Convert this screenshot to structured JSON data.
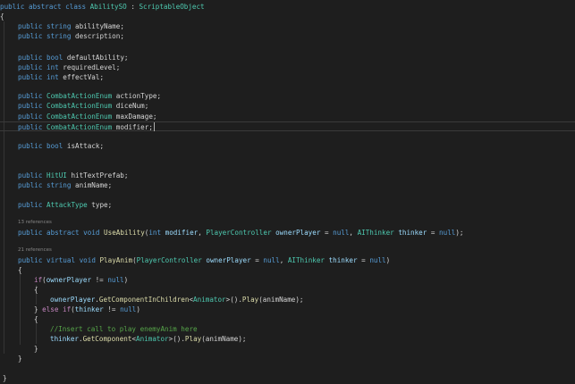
{
  "editor": {
    "language": "csharp",
    "theme": {
      "background": "#1e1e1e",
      "keyword": "#569cd6",
      "type": "#4ec9b0",
      "method": "#dcdcaa",
      "parameter": "#9cdcfe",
      "comment": "#57a64a",
      "control": "#c586c0",
      "plain": "#d4d4d4"
    },
    "codelens": {
      "refs_useability": "13 references",
      "refs_playanim": "21 references"
    },
    "lines": [
      {
        "tokens": [
          [
            "kw",
            "public"
          ],
          [
            "pl",
            " "
          ],
          [
            "kw",
            "abstract"
          ],
          [
            "pl",
            " "
          ],
          [
            "kw",
            "class"
          ],
          [
            "pl",
            " "
          ],
          [
            "typ",
            "AbilitySO"
          ],
          [
            "pl",
            " : "
          ],
          [
            "typ",
            "ScriptableObject"
          ]
        ]
      },
      {
        "tokens": [
          [
            "pl",
            "{"
          ]
        ]
      },
      {
        "tokens": [
          [
            "kw",
            "public"
          ],
          [
            "pl",
            " "
          ],
          [
            "kw",
            "string"
          ],
          [
            "pl",
            " abilityName;"
          ]
        ]
      },
      {
        "tokens": [
          [
            "kw",
            "public"
          ],
          [
            "pl",
            " "
          ],
          [
            "kw",
            "string"
          ],
          [
            "pl",
            " description;"
          ]
        ]
      },
      {
        "tokens": [
          [
            "kw",
            "public"
          ],
          [
            "pl",
            " "
          ],
          [
            "kw",
            "bool"
          ],
          [
            "pl",
            " defaultAbility;"
          ]
        ]
      },
      {
        "tokens": [
          [
            "kw",
            "public"
          ],
          [
            "pl",
            " "
          ],
          [
            "kw",
            "int"
          ],
          [
            "pl",
            " requiredLevel;"
          ]
        ]
      },
      {
        "tokens": [
          [
            "kw",
            "public"
          ],
          [
            "pl",
            " "
          ],
          [
            "kw",
            "int"
          ],
          [
            "pl",
            " effectVal;"
          ]
        ]
      },
      {
        "tokens": [
          [
            "kw",
            "public"
          ],
          [
            "pl",
            " "
          ],
          [
            "typ",
            "CombatActionEnum"
          ],
          [
            "pl",
            " actionType;"
          ]
        ]
      },
      {
        "tokens": [
          [
            "kw",
            "public"
          ],
          [
            "pl",
            " "
          ],
          [
            "typ",
            "CombatActionEnum"
          ],
          [
            "pl",
            " diceNum;"
          ]
        ]
      },
      {
        "tokens": [
          [
            "kw",
            "public"
          ],
          [
            "pl",
            " "
          ],
          [
            "typ",
            "CombatActionEnum"
          ],
          [
            "pl",
            " maxDamage;"
          ]
        ]
      },
      {
        "tokens": [
          [
            "kw",
            "public"
          ],
          [
            "pl",
            " "
          ],
          [
            "typ",
            "CombatActionEnum"
          ],
          [
            "pl",
            " modifier;"
          ]
        ]
      },
      {
        "tokens": [
          [
            "kw",
            "public"
          ],
          [
            "pl",
            " "
          ],
          [
            "kw",
            "bool"
          ],
          [
            "pl",
            " isAttack;"
          ]
        ]
      },
      {
        "tokens": [
          [
            "kw",
            "public"
          ],
          [
            "pl",
            " "
          ],
          [
            "typ",
            "HitUI"
          ],
          [
            "pl",
            " hitTextPrefab;"
          ]
        ]
      },
      {
        "tokens": [
          [
            "kw",
            "public"
          ],
          [
            "pl",
            " "
          ],
          [
            "kw",
            "string"
          ],
          [
            "pl",
            " animName;"
          ]
        ]
      },
      {
        "tokens": [
          [
            "kw",
            "public"
          ],
          [
            "pl",
            " "
          ],
          [
            "typ",
            "AttackType"
          ],
          [
            "pl",
            " type;"
          ]
        ]
      },
      {
        "tokens": [
          [
            "kw",
            "public"
          ],
          [
            "pl",
            " "
          ],
          [
            "kw",
            "abstract"
          ],
          [
            "pl",
            " "
          ],
          [
            "kw",
            "void"
          ],
          [
            "pl",
            " "
          ],
          [
            "fn",
            "UseAbility"
          ],
          [
            "pl",
            "("
          ],
          [
            "kw",
            "int"
          ],
          [
            "pl",
            " "
          ],
          [
            "param",
            "modifier"
          ],
          [
            "pl",
            ", "
          ],
          [
            "typ",
            "PlayerController"
          ],
          [
            "pl",
            " "
          ],
          [
            "param",
            "ownerPlayer"
          ],
          [
            "pl",
            " = "
          ],
          [
            "kw",
            "null"
          ],
          [
            "pl",
            ", "
          ],
          [
            "typ",
            "AIThinker"
          ],
          [
            "pl",
            " "
          ],
          [
            "param",
            "thinker"
          ],
          [
            "pl",
            " = "
          ],
          [
            "kw",
            "null"
          ],
          [
            "pl",
            ");"
          ]
        ]
      },
      {
        "tokens": [
          [
            "kw",
            "public"
          ],
          [
            "pl",
            " "
          ],
          [
            "kw",
            "virtual"
          ],
          [
            "pl",
            " "
          ],
          [
            "kw",
            "void"
          ],
          [
            "pl",
            " "
          ],
          [
            "fn",
            "PlayAnim"
          ],
          [
            "pl",
            "("
          ],
          [
            "typ",
            "PlayerController"
          ],
          [
            "pl",
            " "
          ],
          [
            "param",
            "ownerPlayer"
          ],
          [
            "pl",
            " = "
          ],
          [
            "kw",
            "null"
          ],
          [
            "pl",
            ", "
          ],
          [
            "typ",
            "AIThinker"
          ],
          [
            "pl",
            " "
          ],
          [
            "param",
            "thinker"
          ],
          [
            "pl",
            " = "
          ],
          [
            "kw",
            "null"
          ],
          [
            "pl",
            ")"
          ]
        ]
      },
      {
        "tokens": [
          [
            "pl",
            "{"
          ]
        ]
      },
      {
        "tokens": [
          [
            "ctl",
            "if"
          ],
          [
            "pl",
            "("
          ],
          [
            "param",
            "ownerPlayer"
          ],
          [
            "pl",
            " != "
          ],
          [
            "kw",
            "null"
          ],
          [
            "pl",
            ")"
          ]
        ]
      },
      {
        "tokens": [
          [
            "pl",
            "{"
          ]
        ]
      },
      {
        "tokens": [
          [
            "param",
            "ownerPlayer"
          ],
          [
            "pl",
            "."
          ],
          [
            "fn",
            "GetComponentInChildren"
          ],
          [
            "pl",
            "<"
          ],
          [
            "typ",
            "Animator"
          ],
          [
            "pl",
            ">()."
          ],
          [
            "fn",
            "Play"
          ],
          [
            "pl",
            "(animName);"
          ]
        ]
      },
      {
        "tokens": [
          [
            "pl",
            "} "
          ],
          [
            "ctl",
            "else if"
          ],
          [
            "pl",
            "("
          ],
          [
            "param",
            "thinker"
          ],
          [
            "pl",
            " != "
          ],
          [
            "kw",
            "null"
          ],
          [
            "pl",
            ")"
          ]
        ]
      },
      {
        "tokens": [
          [
            "pl",
            "{"
          ]
        ]
      },
      {
        "tokens": [
          [
            "cmt",
            "//Insert call to play enemyAnim here"
          ]
        ]
      },
      {
        "tokens": [
          [
            "param",
            "thinker"
          ],
          [
            "pl",
            "."
          ],
          [
            "fn",
            "GetComponent"
          ],
          [
            "pl",
            "<"
          ],
          [
            "typ",
            "Animator"
          ],
          [
            "pl",
            ">()."
          ],
          [
            "fn",
            "Play"
          ],
          [
            "pl",
            "(animName);"
          ]
        ]
      },
      {
        "tokens": [
          [
            "pl",
            "}"
          ]
        ]
      },
      {
        "tokens": [
          [
            "pl",
            "}"
          ]
        ]
      },
      {
        "tokens": [
          [
            "pl",
            "}"
          ]
        ]
      }
    ]
  }
}
